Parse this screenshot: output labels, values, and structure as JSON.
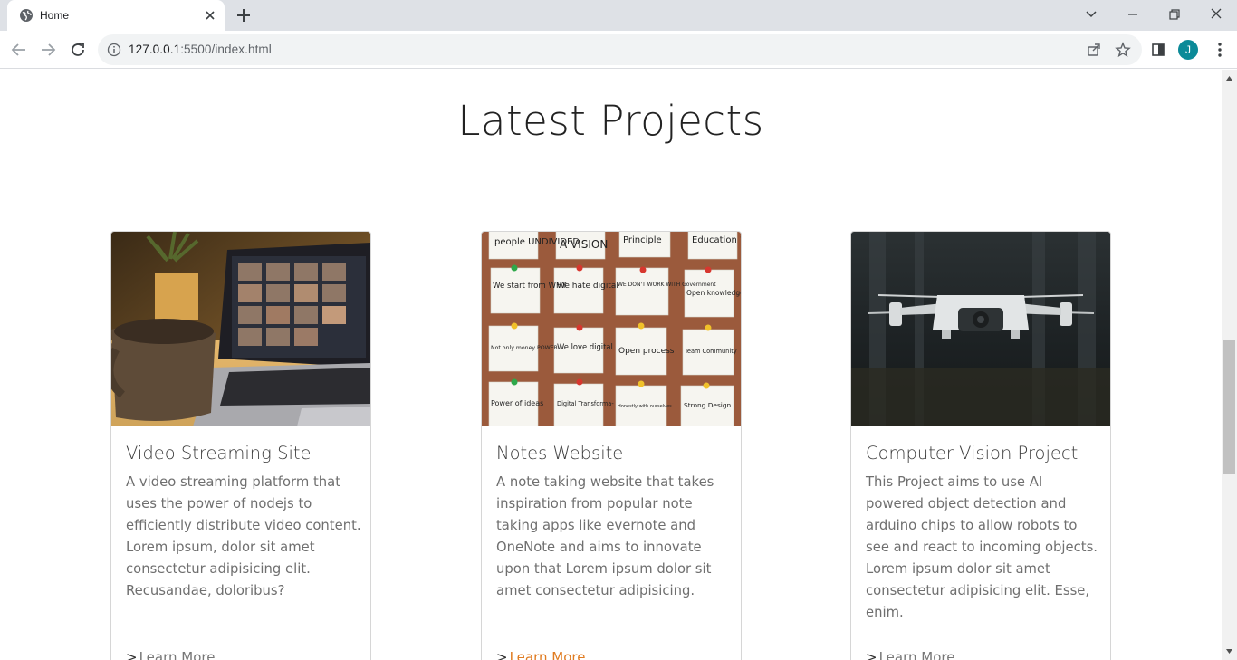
{
  "browser": {
    "tab": {
      "title": "Home"
    },
    "address": {
      "host": "127.0.0.1",
      "rest": ":5500/index.html"
    },
    "profile_initial": "J"
  },
  "page": {
    "heading": "Latest Projects",
    "cards": [
      {
        "title": "Video Streaming Site",
        "text": "A video streaming platform that uses the power of nodejs to efficiently distribute video content. Lorem ipsum, dolor sit amet consectetur adipisicing elit. Recusandae, doloribus?",
        "link": "Learn More"
      },
      {
        "title": "Notes Website",
        "text": "A note taking website that takes inspiration from popular note taking apps like evernote and OneNote and aims to innovate upon that Lorem ipsum dolor sit amet consectetur adipisicing.",
        "link": "Learn More"
      },
      {
        "title": "Computer Vision Project",
        "text": "This Project aims to use AI powered object detection and arduino chips to allow robots to see and react to incoming objects. Lorem ipsum dolor sit amet consectetur adipisicing elit. Esse, enim.",
        "link": "Learn More"
      }
    ],
    "notes_image_text": [
      "people UNDIVIDED",
      "A VISION",
      "Principle",
      "Education ? ? ?",
      "We start from WHY",
      "We hate digital",
      "WE DON'T WORK WITH Government",
      "Open knowledge",
      "Not only money POWER",
      "We love digital",
      "Open process",
      "Team Community",
      "Power of ideas",
      "Digital Transforma-",
      "Honestly with ourselves",
      "Strong Design"
    ]
  },
  "colors": {
    "accent_link": "#e07b20",
    "avatar": "#0b8a98"
  }
}
